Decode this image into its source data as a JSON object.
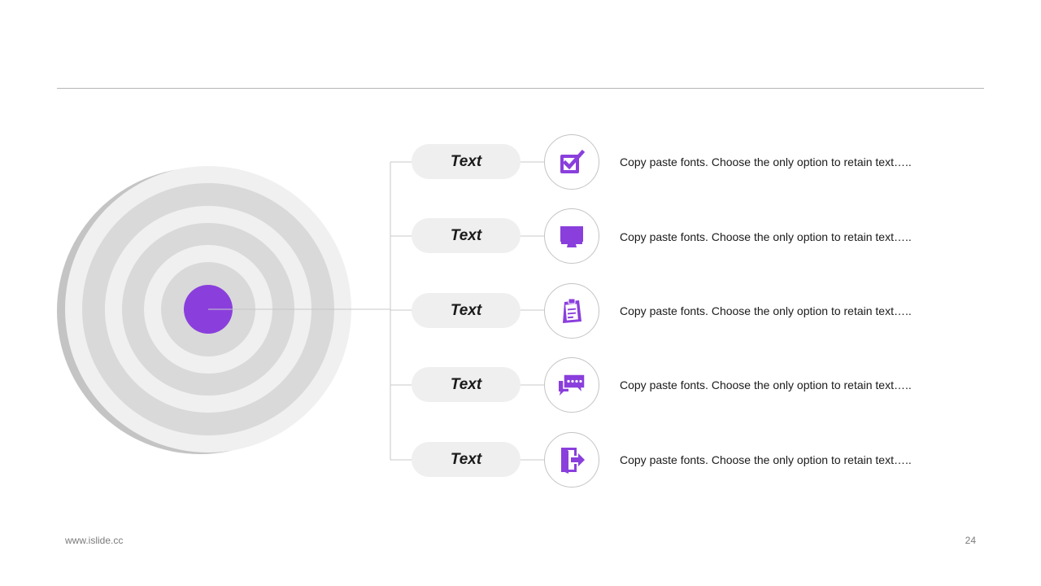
{
  "colors": {
    "accent": "#8a3fdc",
    "ring_light": "#f0f0f0",
    "ring_dark": "#d9d9d9",
    "pill_bg": "#efefef",
    "connector": "#c8c8c8"
  },
  "items": [
    {
      "label": "Text",
      "icon": "checkbox-icon",
      "description": "Copy paste fonts. Choose the only option to retain text….."
    },
    {
      "label": "Text",
      "icon": "monitor-icon",
      "description": "Copy paste fonts. Choose the only option to retain text….."
    },
    {
      "label": "Text",
      "icon": "clipboard-icon",
      "description": "Copy paste fonts. Choose the only option to retain text….."
    },
    {
      "label": "Text",
      "icon": "chat-icon",
      "description": "Copy paste fonts. Choose the only option to retain text….."
    },
    {
      "label": "Text",
      "icon": "exit-door-icon",
      "description": "Copy paste fonts. Choose the only option to retain text….."
    }
  ],
  "footer": {
    "website": "www.islide.cc",
    "page_number": "24"
  }
}
